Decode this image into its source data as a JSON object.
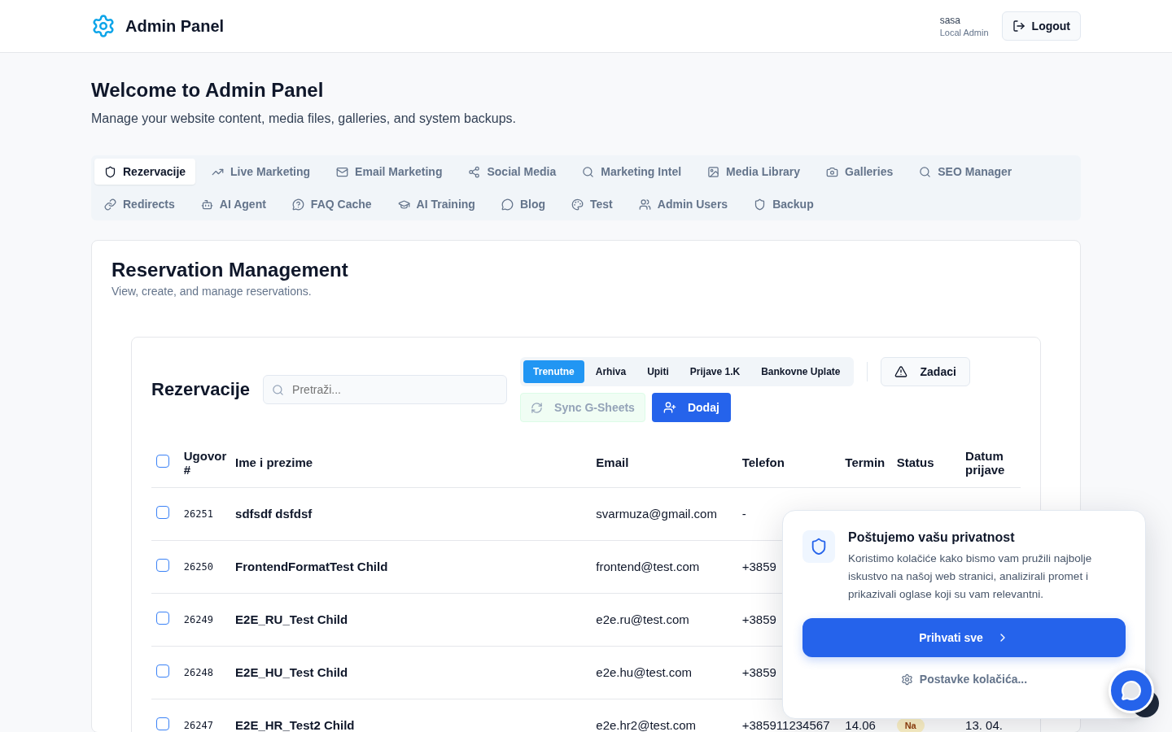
{
  "header": {
    "title": "Admin Panel",
    "user": {
      "name": "sasa",
      "role": "Local Admin"
    },
    "logout": "Logout"
  },
  "page": {
    "title": "Welcome to Admin Panel",
    "subtitle": "Manage your website content, media files, galleries, and system backups."
  },
  "tabs": [
    {
      "label": "Rezervacije",
      "selected": true
    },
    {
      "label": "Live Marketing",
      "selected": false
    },
    {
      "label": "Email Marketing",
      "selected": false
    },
    {
      "label": "Social Media",
      "selected": false
    },
    {
      "label": "Marketing Intel",
      "selected": false
    },
    {
      "label": "Media Library",
      "selected": false
    },
    {
      "label": "Galleries",
      "selected": false
    },
    {
      "label": "SEO Manager",
      "selected": false
    },
    {
      "label": "Redirects",
      "selected": false
    },
    {
      "label": "AI Agent",
      "selected": false
    },
    {
      "label": "FAQ Cache",
      "selected": false
    },
    {
      "label": "AI Training",
      "selected": false
    },
    {
      "label": "Blog",
      "selected": false
    },
    {
      "label": "Test",
      "selected": false
    },
    {
      "label": "Admin Users",
      "selected": false
    },
    {
      "label": "Backup",
      "selected": false
    }
  ],
  "section": {
    "title": "Reservation Management",
    "subtitle": "View, create, and manage reservations."
  },
  "reservations": {
    "title": "Rezervacije",
    "search": {
      "placeholder": "Pretraži..."
    },
    "views": [
      {
        "label": "Trenutne",
        "selected": true
      },
      {
        "label": "Arhiva",
        "selected": false
      },
      {
        "label": "Upiti",
        "selected": false
      },
      {
        "label": "Prijave 1.K",
        "selected": false
      },
      {
        "label": "Bankovne Uplate",
        "selected": false
      }
    ],
    "tasks_button": "Zadaci",
    "sync_button": "Sync G-Sheets",
    "add_button": "Dodaj",
    "table": {
      "select_all": {
        "checked": false
      },
      "columns": [
        "Ugovor #",
        "Ime i prezime",
        "Email",
        "Telefon",
        "Termin",
        "Status",
        "Datum prijave"
      ],
      "rows": [
        {
          "checked": false,
          "contract": "26251",
          "name": "sdfsdf dsfdsf",
          "email": "svarmuza@gmail.com",
          "phone": "-"
        },
        {
          "checked": false,
          "contract": "26250",
          "name": "FrontendFormatTest Child",
          "email": "frontend@test.com",
          "phone": "+3859"
        },
        {
          "checked": false,
          "contract": "26249",
          "name": "E2E_RU_Test Child",
          "email": "e2e.ru@test.com",
          "phone": "+3859"
        },
        {
          "checked": false,
          "contract": "26248",
          "name": "E2E_HU_Test Child",
          "email": "e2e.hu@test.com",
          "phone": "+3859"
        },
        {
          "checked": false,
          "contract": "26247",
          "name": "E2E_HR_Test2 Child",
          "email": "e2e.hr2@test.com",
          "phone": "+385911234567",
          "term": "14.06",
          "status": "Na",
          "date": "13. 04."
        }
      ]
    }
  },
  "cookie_banner": {
    "title": "Poštujemo vašu privatnost",
    "text": "Koristimo kolačiće kako bismo vam pružili najbolje iskustvo na našoj web stranici, analizirali promet i prikazivali oglase koji su vam relevantni.",
    "accept": "Prihvati sve",
    "settings": "Postavke kolačića..."
  }
}
